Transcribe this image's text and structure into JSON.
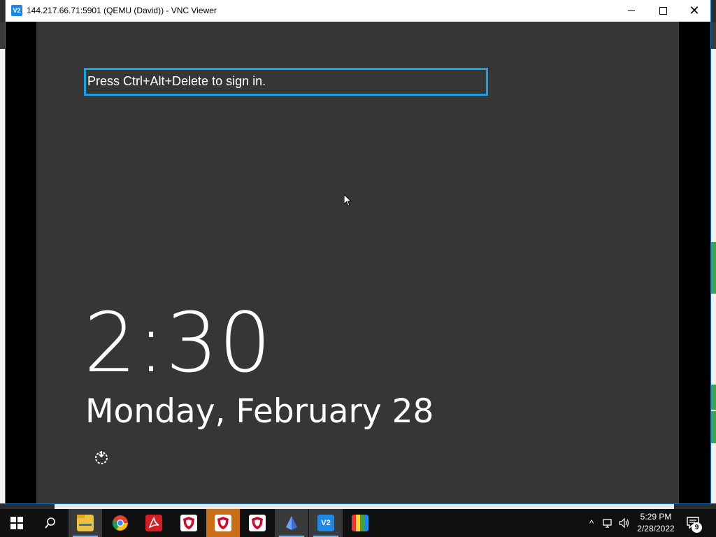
{
  "window": {
    "title": "144.217.66.71:5901 (QEMU (David)) - VNC Viewer",
    "app_icon_label": "V2",
    "minimize_icon": "minimize-icon",
    "maximize_icon": "maximize-icon",
    "close_glyph": "✕"
  },
  "lockscreen": {
    "signin_prompt": "Press Ctrl+Alt+Delete to sign in.",
    "time": "2:30",
    "date": "Monday, February 28",
    "accessibility_icon": "ease-of-access-icon",
    "accent_color": "#1ba1e2"
  },
  "taskbar": {
    "items": [
      {
        "name": "start",
        "icon": "windows-logo-icon"
      },
      {
        "name": "search",
        "icon": "search-icon"
      },
      {
        "name": "file-explorer",
        "icon": "folder-icon"
      },
      {
        "name": "chrome",
        "icon": "chrome-icon"
      },
      {
        "name": "acrobat",
        "icon": "acrobat-icon"
      },
      {
        "name": "mcafee-1",
        "icon": "shield-icon"
      },
      {
        "name": "mcafee-2",
        "icon": "shield-icon"
      },
      {
        "name": "mcafee-3",
        "icon": "shield-icon"
      },
      {
        "name": "app-blue",
        "icon": "crystal-icon"
      },
      {
        "name": "vnc-viewer",
        "icon": "vnc-icon"
      },
      {
        "name": "avg",
        "icon": "avg-icon"
      }
    ],
    "clock_time": "5:29 PM",
    "clock_date": "2/28/2022",
    "notification_count": "9"
  }
}
